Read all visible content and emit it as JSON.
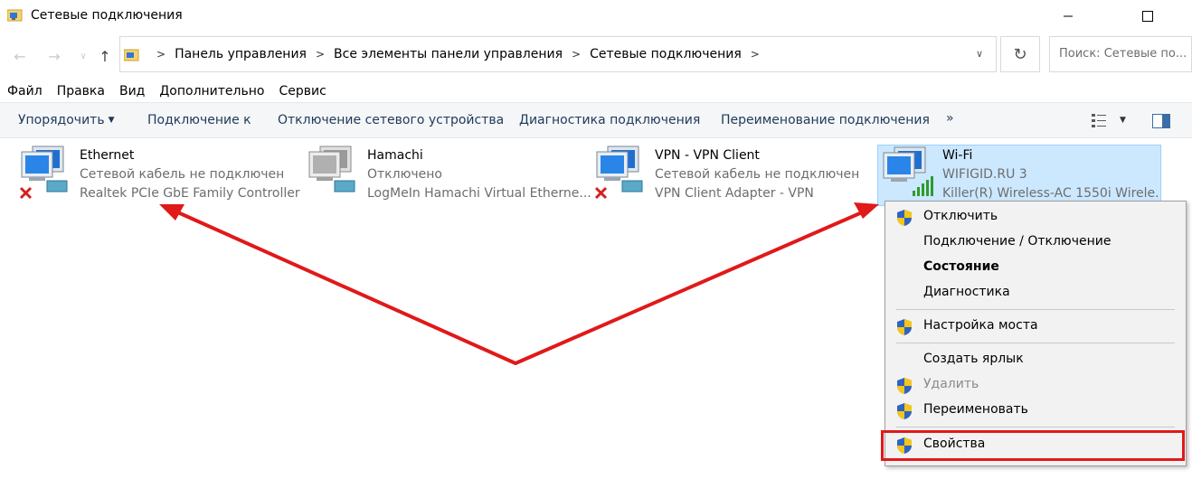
{
  "window": {
    "title": "Сетевые подключения"
  },
  "address": {
    "crumbs": [
      "Панель управления",
      "Все элементы панели управления",
      "Сетевые подключения"
    ],
    "search_placeholder": "Поиск: Сетевые по..."
  },
  "menu": [
    "Файл",
    "Правка",
    "Вид",
    "Дополнительно",
    "Сервис"
  ],
  "commands": {
    "organize": "Упорядочить",
    "connect": "Подключение к",
    "disable": "Отключение сетевого устройства",
    "diagnose": "Диагностика подключения",
    "rename": "Переименование подключения",
    "more": "»"
  },
  "connections": [
    {
      "name": "Ethernet",
      "status": "Сетевой кабель не подключен",
      "device": "Realtek PCIe GbE Family Controller"
    },
    {
      "name": "Hamachi",
      "status": "Отключено",
      "device": "LogMeIn Hamachi Virtual Etherne..."
    },
    {
      "name": "VPN - VPN Client",
      "status": "Сетевой кабель не подключен",
      "device": "VPN Client Adapter - VPN"
    },
    {
      "name": "Wi-Fi",
      "status": "WIFIGID.RU 3",
      "device": "Killer(R) Wireless-AC 1550i Wirele..."
    }
  ],
  "context_menu": {
    "disable": "Отключить",
    "connect_disconnect": "Подключение / Отключение",
    "status": "Состояние",
    "diagnostics": "Диагностика",
    "bridge": "Настройка моста",
    "shortcut": "Создать ярлык",
    "delete": "Удалить",
    "rename": "Переименовать",
    "properties": "Свойства"
  },
  "colors": {
    "selection": "#cce8ff",
    "annotation_red": "#e01919",
    "command_text": "#1e395b"
  }
}
